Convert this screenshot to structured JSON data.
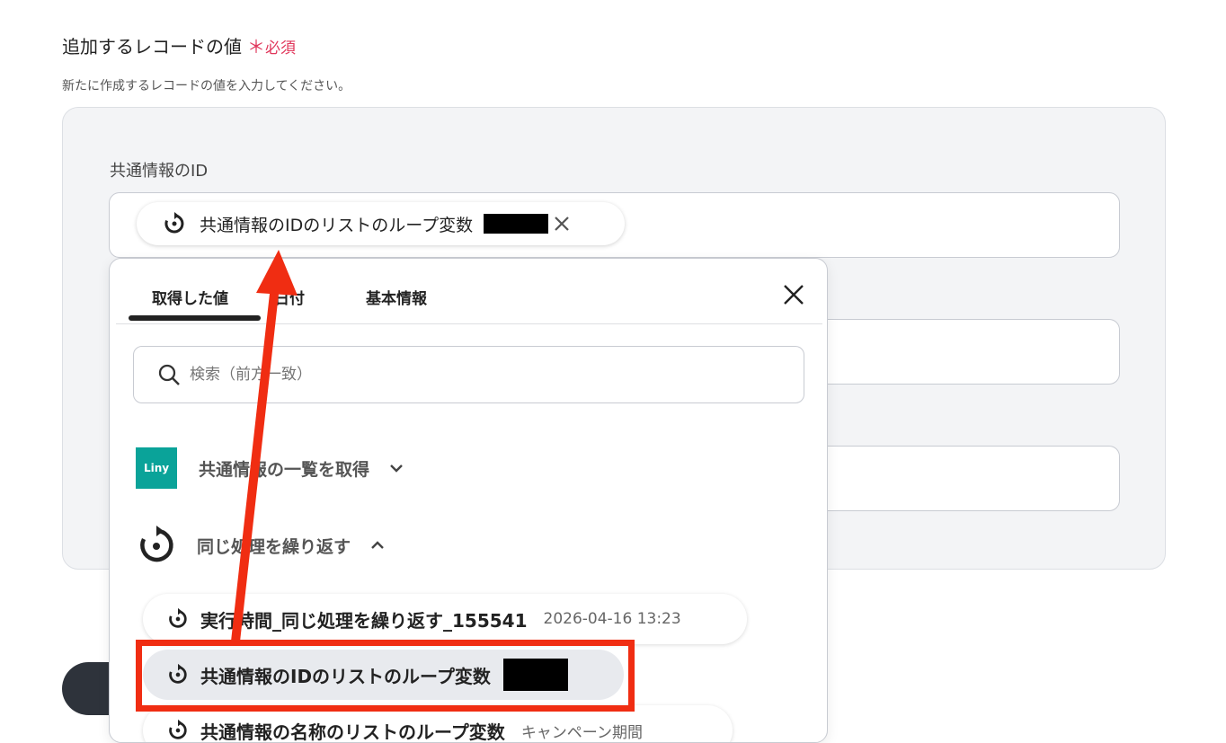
{
  "section": {
    "title": "追加するレコードの値",
    "required_mark": "＊",
    "required_label": "必須",
    "description": "新たに作成するレコードの値を入力してください。"
  },
  "field": {
    "label": "共通情報のID",
    "chip_text": "共通情報のIDのリストのループ変数"
  },
  "popup": {
    "tabs": [
      {
        "label": "取得した値",
        "active": true
      },
      {
        "label": "日付",
        "active": false
      },
      {
        "label": "基本情報",
        "active": false
      }
    ],
    "search_placeholder": "検索（前方一致）",
    "groups": [
      {
        "icon": "liny-logo",
        "logo_text": "Liny",
        "label": "共通情報の一覧を取得",
        "expanded": false
      },
      {
        "icon": "loop-icon",
        "label": "同じ処理を繰り返す",
        "expanded": true
      }
    ],
    "items": [
      {
        "name": "実行時間_同じ処理を繰り返す_155541",
        "value": "2026-04-16 13:23"
      },
      {
        "name": "共通情報のIDのリストのループ変数",
        "value": "",
        "selected": true
      },
      {
        "name": "共通情報の名称のリストのループ変数",
        "value": "キャンペーン期間"
      }
    ]
  },
  "colors": {
    "required": "#e0375b",
    "annotation": "#f02d12",
    "liny_brand": "#0aa399"
  }
}
